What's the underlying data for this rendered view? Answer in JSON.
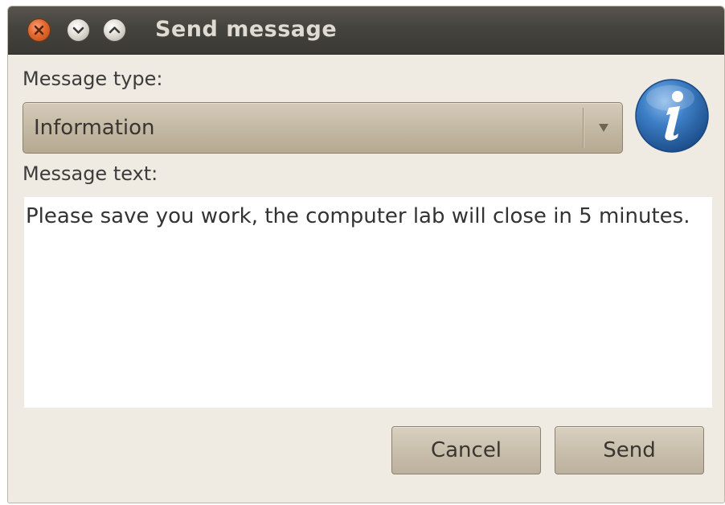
{
  "window": {
    "title": "Send message"
  },
  "title_bar": {
    "controls": [
      {
        "name": "close",
        "icon": "close-icon"
      },
      {
        "name": "minimize",
        "icon": "minimize-icon"
      },
      {
        "name": "maximize",
        "icon": "maximize-icon"
      }
    ]
  },
  "form": {
    "message_type_label": "Message type:",
    "message_type_value": "Information",
    "message_type_icon": "info-icon",
    "message_text_label": "Message text:",
    "message_text_value": "Please save you work, the computer lab will close in 5 minutes."
  },
  "buttons": {
    "cancel_label": "Cancel",
    "send_label": "Send"
  },
  "colors": {
    "titlebar": "#45433d",
    "window_background": "#f0ebe2",
    "close_button": "#e2682f",
    "info_icon": "#2f6fb5"
  }
}
